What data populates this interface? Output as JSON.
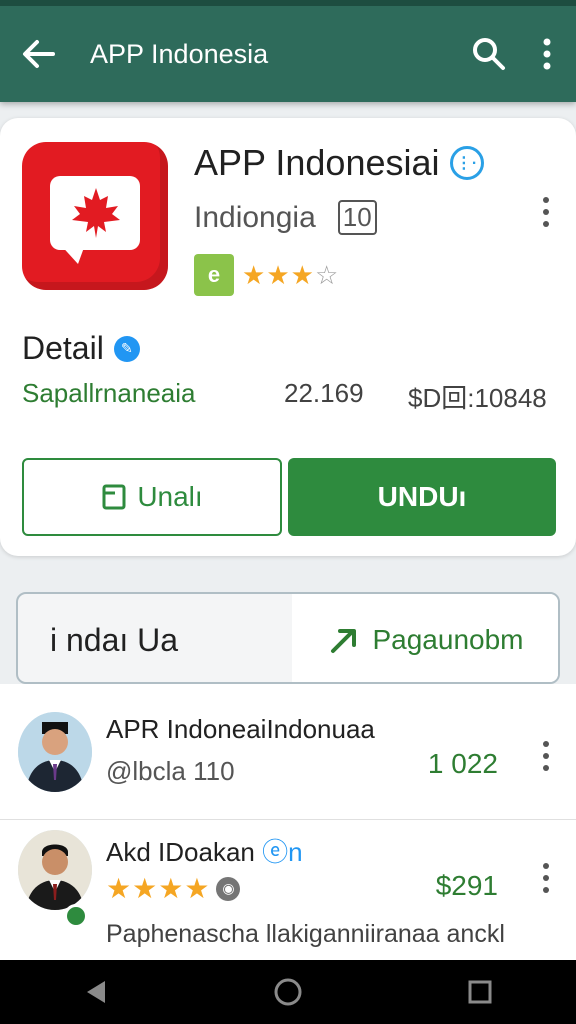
{
  "appbar": {
    "title": "APP Indonesia",
    "icons": [
      "back-arrow-icon",
      "search-icon",
      "more-vert-icon"
    ]
  },
  "app": {
    "name": "APP Indonesiai",
    "developer": "Indiongia",
    "developer_icon_text": "10",
    "rating_badge": "e",
    "rating_stars": 3,
    "rating_max": 5,
    "icon_color": "#e21b22"
  },
  "detail": {
    "heading": "Detail",
    "meta_left": "Sapallrnaneaia",
    "meta_mid": "22.169",
    "meta_right": "$D回:10848"
  },
  "buttons": {
    "secondary_label": "Unalı",
    "primary_label": "UNDUı"
  },
  "tabs": {
    "left": "i ndaı Ua",
    "right": "Pagaunobm"
  },
  "list": [
    {
      "name": "APR IndoneaiIndonuaa",
      "sub": "@lbcla 110",
      "value": "1 022"
    },
    {
      "name": "Akd IDoakan",
      "name_suffix": "ⓔn",
      "stars": 4,
      "value": "$291",
      "description": "Paphenascha llakiganniiranaa anckl"
    }
  ],
  "colors": {
    "appbar": "#2e6b5b",
    "accent": "#2e8b3e",
    "star": "#f5a623"
  }
}
